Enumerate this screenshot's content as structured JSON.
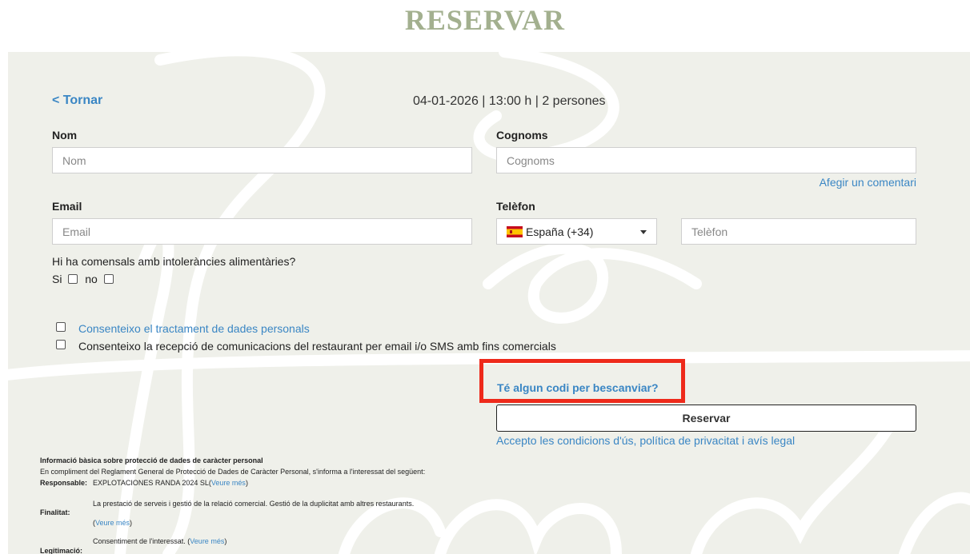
{
  "page": {
    "title": "RESERVAR"
  },
  "header": {
    "back_label": "< Tornar",
    "summary": "04-01-2026 | 13:00 h | 2 persones"
  },
  "form": {
    "nom": {
      "label": "Nom",
      "placeholder": "Nom"
    },
    "cognoms": {
      "label": "Cognoms",
      "placeholder": "Cognoms"
    },
    "add_comment": "Afegir un comentari",
    "email": {
      "label": "Email",
      "placeholder": "Email"
    },
    "telefon": {
      "label": "Telèfon",
      "placeholder": "Telèfon"
    },
    "country": {
      "selected": "España (+34)",
      "flag_icon": "spain-flag-icon"
    },
    "intolerance_question": "Hi ha comensals amb intoleràncies alimentàries?",
    "yes_label": "Si",
    "no_label": "no",
    "consent_data": "Consenteixo el tractament de dades personals",
    "consent_comms": "Consenteixo la recepció de comunicacions del restaurant per email i/o SMS amb fins comercials",
    "redeem_code": "Té algun codi per bescanviar?",
    "reserve_button": "Reservar",
    "terms_link": "Accepto les condicions d'ús, política de privacitat i avís legal"
  },
  "privacy": {
    "heading": "Informació bàsica sobre protecció de dades de caràcter personal",
    "intro": "En compliment del Reglament General de Protecció de Dades de Caràcter Personal, s'informa a l'interessat del següent:",
    "responsable_label": "Responsable:",
    "responsable_value": "EXPLOTACIONES RANDA 2024 SL",
    "finalitat_label": "Finalitat:",
    "finalitat_value": "La prestació de serveis i gestió de la relació comercial. Gestió de la duplicitat amb altres restaurants.",
    "legitimacio_label": "Legitimació:",
    "legitimacio_value": "Consentiment de l'interessat.",
    "more_link": "Veure més",
    "open_paren": "(",
    "close_paren": ")"
  },
  "colors": {
    "title": "#a3b08f",
    "panel_bg": "#eff0ea",
    "link": "#3a86c4",
    "highlight": "#ee2a1b"
  }
}
